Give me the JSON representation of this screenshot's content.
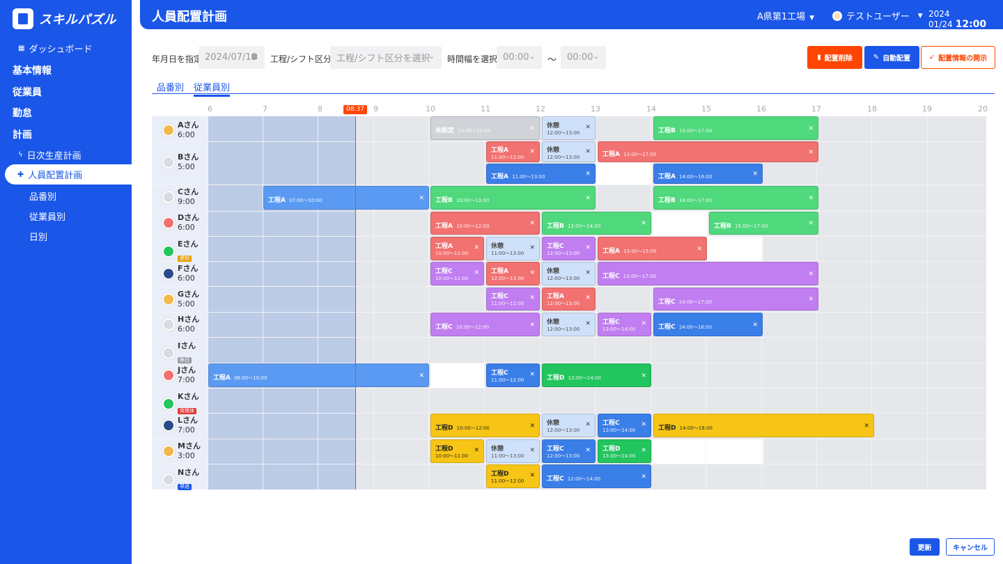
{
  "app": {
    "logo_text": "スキルパズル"
  },
  "sidebar": {
    "dashboard": "ダッシュボード",
    "basic": "基本情報",
    "employees": "従業員",
    "attendance": "勤怠",
    "planning": "計画",
    "daily_plan": "日次生産計画",
    "staff_plan": "人員配置計画",
    "by_part": "品番別",
    "by_employee": "従業員別",
    "by_day": "日別"
  },
  "header": {
    "title": "人員配置計画",
    "factory": "A県第1工場",
    "user": "テストユーザー",
    "date": "2024 01/24",
    "time": "12:00"
  },
  "filters": {
    "date_label": "年月日を指定",
    "date_value": "2024/07/10",
    "process_label": "工程/シフト区分",
    "process_placeholder": "工程/シフト区分を選択",
    "time_label": "時間幅を選択",
    "time_from": "00:00",
    "time_to": "00:00",
    "tilde": "～"
  },
  "actions": {
    "delete": "配置削除",
    "auto": "自動配置",
    "publish": "配置情報の開示"
  },
  "tabs": {
    "by_part": "品番別",
    "by_employee": "従業員別"
  },
  "timeline": {
    "hours": [
      "6",
      "7",
      "8",
      "9",
      "10",
      "11",
      "12",
      "13",
      "14",
      "15",
      "16",
      "17",
      "18",
      "19",
      "20"
    ],
    "now": "08:37"
  },
  "employees": [
    {
      "name": "Aさん",
      "hours": "6:00",
      "color": "#f2b84b"
    },
    {
      "name": "Bさん",
      "hours": "5:00",
      "color": "#e0e6ef"
    },
    {
      "name": "Cさん",
      "hours": "9:00",
      "color": "#e0e6ef"
    },
    {
      "name": "Dさん",
      "hours": "6:00",
      "color": "#f27171"
    },
    {
      "name": "Eさん",
      "badge": "遅刻",
      "badge_color": "#e69b00",
      "color": "#22c55e"
    },
    {
      "name": "Fさん",
      "hours": "6:00",
      "color": "#2a4a8a"
    },
    {
      "name": "Gさん",
      "hours": "5:00",
      "color": "#f2b84b"
    },
    {
      "name": "Hさん",
      "hours": "6:00",
      "color": "#e0e6ef"
    },
    {
      "name": "Iさん",
      "badge": "休日",
      "badge_color": "#9aa0a6",
      "color": "#e0e6ef"
    },
    {
      "name": "Jさん",
      "hours": "7:00",
      "color": "#f27171"
    },
    {
      "name": "Kさん",
      "badge": "突発休",
      "badge_color": "#e53935",
      "color": "#22c55e"
    },
    {
      "name": "Lさん",
      "hours": "7:00",
      "color": "#2a4a8a"
    },
    {
      "name": "Mさん",
      "hours": "3:00",
      "color": "#f2b84b"
    },
    {
      "name": "Nさん",
      "badge": "早退",
      "badge_color": "#1a56e8",
      "color": "#e0e6ef"
    }
  ],
  "blocks": [
    {
      "t": "未設定",
      "time": "10:00～12:00"
    },
    {
      "t": "休憩",
      "time": "12:00～13:00"
    },
    {
      "t": "工程B",
      "time": "13:00～17:00"
    },
    {
      "t": "工程A",
      "time": "11:00～12:00"
    },
    {
      "t": "休憩",
      "time": "12:00～13:00"
    },
    {
      "t": "工程A",
      "time": "13:00～17:00"
    },
    {
      "t": "工程A",
      "time": "11:00～13:00"
    },
    {
      "t": "工程A",
      "time": "14:00～16:00"
    },
    {
      "t": "工程A",
      "time": "07:00～10:00"
    },
    {
      "t": "工程B",
      "time": "10:00～13:00"
    },
    {
      "t": "工程B",
      "time": "14:00～17:00"
    },
    {
      "t": "工程A",
      "time": "10:00～12:00"
    },
    {
      "t": "工程B",
      "time": "12:00～14:00"
    },
    {
      "t": "工程B",
      "time": "15:00～17:00"
    },
    {
      "t": "工程A",
      "time": "10:00～11:00"
    },
    {
      "t": "休憩",
      "time": "11:00～13:00"
    },
    {
      "t": "工程C",
      "time": "12:00～13:00"
    },
    {
      "t": "工程A",
      "time": "13:00～15:00"
    },
    {
      "t": "工程C",
      "time": "10:00～11:00"
    },
    {
      "t": "工程A",
      "time": "12:00～13:00"
    },
    {
      "t": "休憩",
      "time": "12:00～13:00"
    },
    {
      "t": "工程C",
      "time": "13:00～17:00"
    },
    {
      "t": "工程C",
      "time": "11:00～12:00"
    },
    {
      "t": "工程A",
      "time": "12:00～13:00"
    },
    {
      "t": "工程C",
      "time": "14:00～17:00"
    },
    {
      "t": "工程C",
      "time": "10:00～12:00"
    },
    {
      "t": "休憩",
      "time": "12:00～13:00"
    },
    {
      "t": "工程C",
      "time": "13:00～14:00"
    },
    {
      "t": "工程C",
      "time": "14:00～16:00"
    },
    {
      "t": "工程A",
      "time": "06:00～10:00"
    },
    {
      "t": "工程C",
      "time": "11:00～12:00"
    },
    {
      "t": "工程D",
      "time": "12:00～14:00"
    },
    {
      "t": "工程D",
      "time": "10:00～12:00"
    },
    {
      "t": "休憩",
      "time": "12:00～13:00"
    },
    {
      "t": "工程C",
      "time": "13:00～14:00"
    },
    {
      "t": "工程D",
      "time": "14:00～18:00"
    },
    {
      "t": "工程D",
      "time": "10:00～11:00"
    },
    {
      "t": "休憩",
      "time": "11:00～13:00"
    },
    {
      "t": "工程C",
      "time": "12:00～13:00"
    },
    {
      "t": "工程D",
      "time": "13:00～14:00"
    },
    {
      "t": "工程D",
      "time": "11:00～12:00"
    },
    {
      "t": "工程C",
      "time": "12:00～14:00"
    }
  ],
  "footer": {
    "update": "更新",
    "cancel": "キャンセル"
  }
}
